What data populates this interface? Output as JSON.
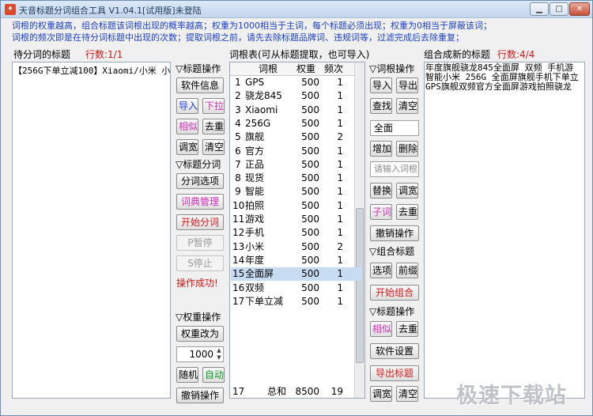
{
  "window": {
    "title": "天音标题分词组合工具 V1.04.1[试用版]未登陆",
    "controls": [
      "minimize-icon",
      "maximize-icon",
      "close-icon"
    ]
  },
  "tips": {
    "line1": "词根的权重越高，组合标题该词根出现的概率越高；权重为1000相当于主词，每个标题必须出现；权重为0相当于屏蔽该词；",
    "line2": "词根的频次即是在待分词标题中出现的次数；提取词根之前，请先去除标题品牌词、违规词等，过滤完成后去除重复；"
  },
  "left": {
    "label": "待分词的标题",
    "count_label": "行数:1/1",
    "content": "【256G下单立减100】Xiaomi/小米 小"
  },
  "title_ops": {
    "header": "▽标题操作",
    "buttons": [
      "软件信息",
      "导入",
      "下拉",
      "相似",
      "去重",
      "调宽",
      "清空"
    ]
  },
  "split_ops": {
    "header": "▽标题分词",
    "buttons": [
      "分词选项",
      "词典管理",
      "开始分词",
      "P暂停",
      "S停止"
    ],
    "status": "操作成功!"
  },
  "weight_ops": {
    "header": "▽权重操作",
    "change_button": "权重改为",
    "value": "1000",
    "buttons": [
      "随机",
      "自动",
      "撤销操作"
    ]
  },
  "table": {
    "label": "词根表(可从标题提取，也可导入)",
    "columns": [
      "词根",
      "权重",
      "频次"
    ],
    "rows": [
      {
        "n": "1",
        "word": "GPS",
        "weight": "500",
        "freq": "1"
      },
      {
        "n": "2",
        "word": "骁龙845",
        "weight": "500",
        "freq": "1"
      },
      {
        "n": "3",
        "word": "Xiaomi",
        "weight": "500",
        "freq": "1"
      },
      {
        "n": "4",
        "word": "256G",
        "weight": "500",
        "freq": "1"
      },
      {
        "n": "5",
        "word": "旗舰",
        "weight": "500",
        "freq": "2"
      },
      {
        "n": "6",
        "word": "官方",
        "weight": "500",
        "freq": "1"
      },
      {
        "n": "7",
        "word": "正品",
        "weight": "500",
        "freq": "1"
      },
      {
        "n": "8",
        "word": "现货",
        "weight": "500",
        "freq": "1"
      },
      {
        "n": "9",
        "word": "智能",
        "weight": "500",
        "freq": "1"
      },
      {
        "n": "10",
        "word": "拍照",
        "weight": "500",
        "freq": "1"
      },
      {
        "n": "11",
        "word": "游戏",
        "weight": "500",
        "freq": "1"
      },
      {
        "n": "12",
        "word": "手机",
        "weight": "500",
        "freq": "1"
      },
      {
        "n": "13",
        "word": "小米",
        "weight": "500",
        "freq": "2"
      },
      {
        "n": "14",
        "word": "年度",
        "weight": "500",
        "freq": "1"
      },
      {
        "n": "15",
        "word": "全面屏",
        "weight": "500",
        "freq": "1"
      },
      {
        "n": "16",
        "word": "双频",
        "weight": "500",
        "freq": "1"
      },
      {
        "n": "17",
        "word": "下单立减",
        "weight": "500",
        "freq": "1"
      }
    ],
    "selected_row": "15",
    "footer": {
      "n": "17",
      "label": "总和",
      "weight": "8500",
      "freq": "19"
    }
  },
  "root_ops": {
    "header": "▽词根操作",
    "buttons": [
      "导入",
      "导出",
      "查找",
      "清空",
      "增加",
      "删除",
      "替换",
      "调宽",
      "子词",
      "去重",
      "撤销操作"
    ],
    "input_value": "全面",
    "input_placeholder": "请输入词根"
  },
  "combine_ops": {
    "header": "▽组合标题",
    "buttons": [
      "选项",
      "前缀",
      "开始组合"
    ]
  },
  "title_ops2": {
    "header": "▽标题操作",
    "buttons": [
      "相似",
      "去重",
      "软件设置",
      "导出标题",
      "调宽",
      "清空"
    ]
  },
  "right": {
    "label": "组合成新的标题",
    "count_label": "行数:4/4",
    "lines": [
      "年度旗舰骁龙845全面屏 双频 手机游",
      "智能小米 256G 全面屏旗舰手机下单立",
      "GPS旗舰双频官方全面屏游戏拍照骁龙"
    ]
  },
  "watermark": "极速下载站"
}
